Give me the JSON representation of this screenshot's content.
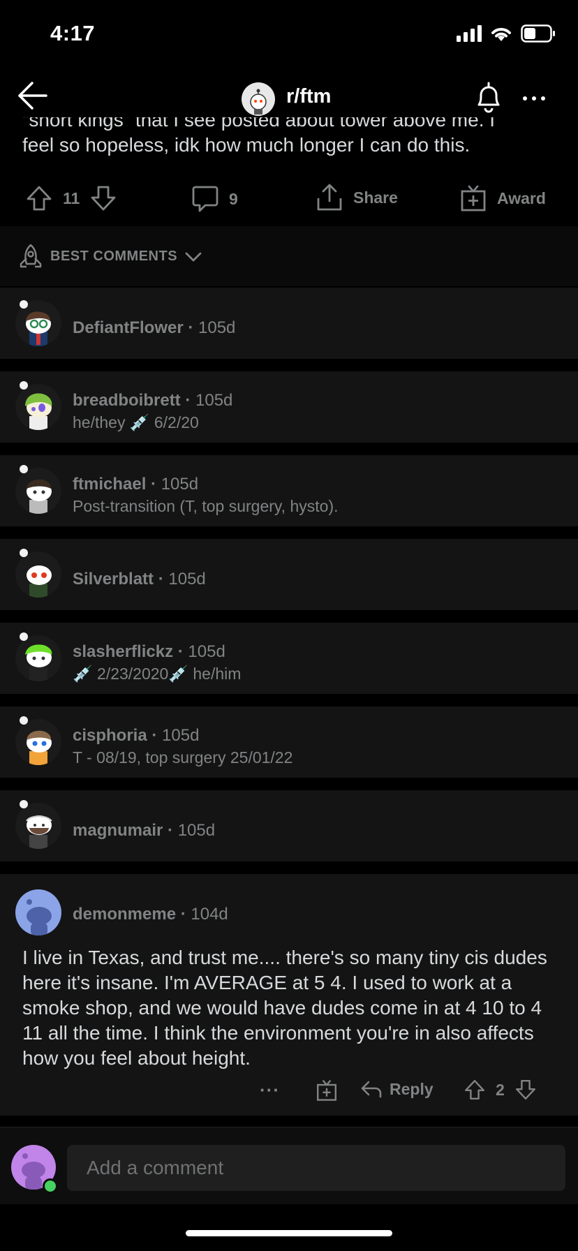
{
  "status": {
    "time": "4:17"
  },
  "header": {
    "subreddit": "r/ftm"
  },
  "post": {
    "text_line1": "“short kings” that I see posted about tower above me. I",
    "text_line2": "feel so hopeless, idk how much longer I can do this.",
    "upvotes": "11",
    "comments": "9",
    "share_label": "Share",
    "award_label": "Award"
  },
  "sort": {
    "label": "BEST COMMENTS"
  },
  "comments": [
    {
      "user": "DefiantFlower",
      "age": "105d",
      "flair": ""
    },
    {
      "user": "breadboibrett",
      "age": "105d",
      "flair": "he/they 💉 6/2/20"
    },
    {
      "user": "ftmichael",
      "age": "105d",
      "flair": "Post-transition (T, top surgery, hysto)."
    },
    {
      "user": "Silverblatt",
      "age": "105d",
      "flair": ""
    },
    {
      "user": "slasherflickz",
      "age": "105d",
      "flair": "💉 2/23/2020💉  he/him"
    },
    {
      "user": "cisphoria",
      "age": "105d",
      "flair": "T - 08/19, top surgery 25/01/22"
    },
    {
      "user": "magnumair",
      "age": "105d",
      "flair": ""
    }
  ],
  "expanded_comment": {
    "user": "demonmeme",
    "age": "104d",
    "text": "I live in Texas, and trust me.... there's so many tiny cis dudes here it's insane. I'm AVERAGE at 5 4. I used to work at a smoke shop, and we would have dudes come in at 4 10 to 4 11 all the time. I think the environment you're in also affects how you feel about height.",
    "more_label": "···",
    "reply_label": "Reply",
    "score": "2"
  },
  "composer": {
    "placeholder": "Add a comment"
  },
  "colors": {
    "background": "#000000",
    "row": "#141414",
    "muted": "#818384",
    "text": "#d7dadc",
    "online": "#46d160"
  }
}
